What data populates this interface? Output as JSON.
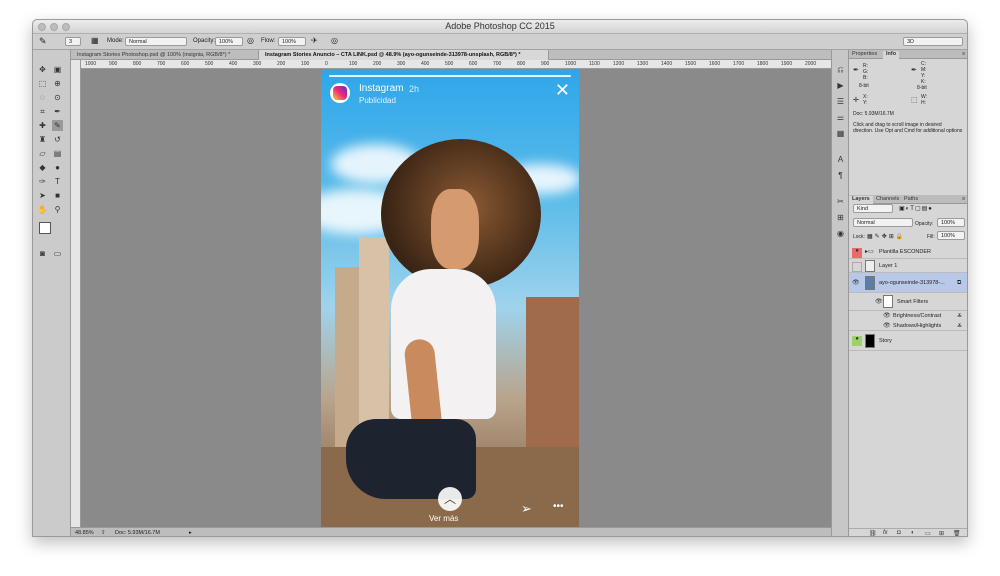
{
  "app": {
    "title": "Adobe Photoshop CC 2015"
  },
  "options_bar": {
    "mode_label": "Mode:",
    "mode_value": "Normal",
    "opacity_label": "Opacity:",
    "opacity_value": "100%",
    "flow_label": "Flow:",
    "flow_value": "100%",
    "brush_size": "3",
    "workspace": "3D"
  },
  "tabs": [
    {
      "label": "Instagram Stories Photoshop.psd @ 100% (insignia, RGB/8*) *"
    },
    {
      "label": "Instagram Stories Anuncio – CTA LINK.psd @ 48.9% (ayo-ogunseinde-313978-unsplash, RGB/8*) *"
    }
  ],
  "ruler_ticks": [
    "1000",
    "900",
    "800",
    "700",
    "600",
    "500",
    "400",
    "300",
    "200",
    "100",
    "0",
    "100",
    "200",
    "300",
    "400",
    "500",
    "600",
    "700",
    "800",
    "900",
    "1000",
    "1100",
    "1200",
    "1300",
    "1400",
    "1500",
    "1600",
    "1700",
    "1800",
    "1900",
    "2000"
  ],
  "story": {
    "account": "Instagram",
    "time": "2h",
    "subtitle": "Publicidad",
    "close_glyph": "✕",
    "cta_label": "Ver más",
    "cta_glyph": "︿",
    "send_glyph": "➢",
    "more_glyph": "•••"
  },
  "status": {
    "zoom": "48.85%",
    "doc": "Doc: 5.93M/16.7M"
  },
  "info_panel": {
    "tabs": [
      "Properties",
      "Info"
    ],
    "active_tab": "Info",
    "rgb": [
      "R:",
      "G:",
      "B:"
    ],
    "cmyk": [
      "C:",
      "M:",
      "Y:",
      "K:"
    ],
    "bit_left": "8-bit",
    "bit_right": "8-bit",
    "x_label": "X:",
    "y_label": "Y:",
    "w_label": "W:",
    "h_label": "H:",
    "doc": "Doc: 5.93M/16.7M",
    "hint": "Click and drag to scroll image in desired direction.  Use Opt and Cmd for additional options"
  },
  "layers_panel": {
    "tabs": [
      "Layers",
      "Channels",
      "Paths"
    ],
    "active_tab": "Layers",
    "filter": "Kind",
    "blend": "Normal",
    "opacity_label": "Opacity:",
    "opacity_value": "100%",
    "lock_label": "Lock:",
    "fill_label": "Fill:",
    "fill_value": "100%",
    "layers": [
      {
        "name": "Plantilla ESCONDER"
      },
      {
        "name": "Layer 1"
      },
      {
        "name": "ayo-ogunseinde-313978-..."
      },
      {
        "name": "Smart Filters"
      },
      {
        "name": "Brightness/Contrast"
      },
      {
        "name": "Shadows/Highlights"
      },
      {
        "name": "Story"
      }
    ],
    "footer_icons": [
      "link-icon",
      "fx-icon",
      "mask-icon",
      "adjustment-icon",
      "folder-icon",
      "new-layer-icon",
      "trash-icon"
    ]
  },
  "colors": {
    "accent": "#3b82f6",
    "eye_red": "#e86a6a",
    "eye_green": "#9bd36a"
  }
}
